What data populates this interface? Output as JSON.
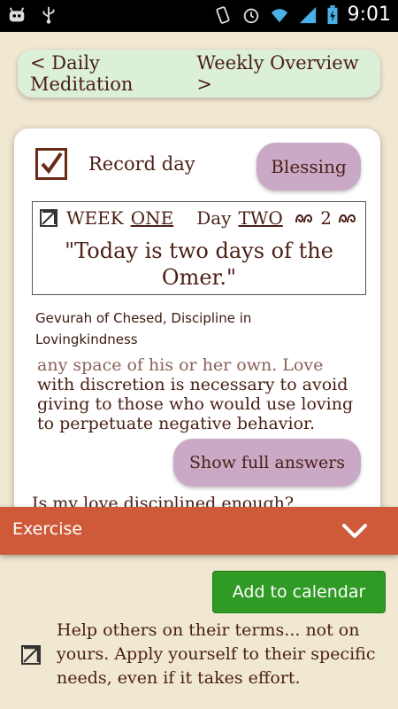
{
  "status_bar": {
    "time": "9:01",
    "icons": [
      "android-icon",
      "usb-icon",
      "vibrate-icon",
      "alarm-icon",
      "wifi-icon",
      "signal-icon",
      "battery-icon"
    ]
  },
  "top_nav": {
    "daily_label": "< Daily Meditation",
    "weekly_label": "Weekly Overview >"
  },
  "card": {
    "record_label": "Record day",
    "record_checked": true,
    "blessing_label": "Blessing",
    "week_word": "WEEK",
    "week_value": "ONE",
    "day_word": "Day",
    "day_value": "TWO",
    "day_number": "2",
    "quote": "\"Today is two days of the Omer.\"",
    "sefirah": "Gevurah of Chesed, Discipline in Lovingkindness",
    "body_partial": "any space of his or her own. Love",
    "body_text": "with discretion is necessary to avoid giving to those who would use loving to perpetuate negative behavior.",
    "full_answers_label": "Show full answers",
    "question": "Is my love disciplined enough?"
  },
  "exercise": {
    "label": "Exercise",
    "calendar_label": "Add to calendar",
    "text": "Help others on their terms... not on yours. Apply yourself to their specific needs, even if it takes effort.",
    "checked": true
  },
  "colors": {
    "accent_bar": "#cf5a3a",
    "button_purple": "#c9a9c6",
    "calendar_green": "#2f9a24",
    "nav_green": "#dcefd8",
    "text_brown": "#4a1f14"
  }
}
